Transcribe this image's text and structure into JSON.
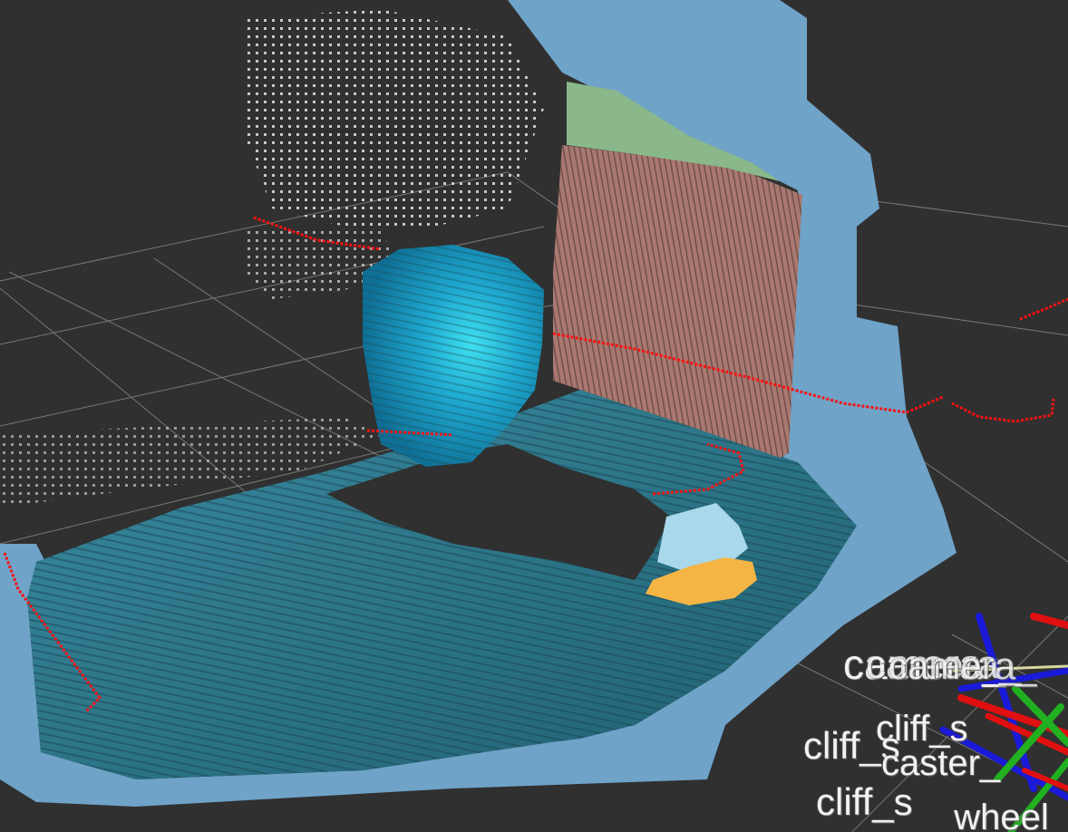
{
  "viewport": {
    "background_color": "#303030",
    "grid_color": "#9a9a9a",
    "colors": {
      "floor_blue": "#6fa3c8",
      "floor_teal": "#2f7f92",
      "wall_salmon": "#a97870",
      "wall_green": "#8ab88a",
      "laser_scan": "#ff1010",
      "object_cyan": "#2bb6da",
      "object_yellow": "#f5b545",
      "object_light_blue": "#a8d8ea",
      "axis_red": "#e01010",
      "axis_green": "#20b020",
      "axis_blue": "#1a1ad8"
    }
  },
  "tf_frame_labels": [
    "camera_",
    "camera_",
    "camera_",
    "cliff_s",
    "cliff_s",
    "caster_",
    "cliff_s",
    "_wheel"
  ]
}
